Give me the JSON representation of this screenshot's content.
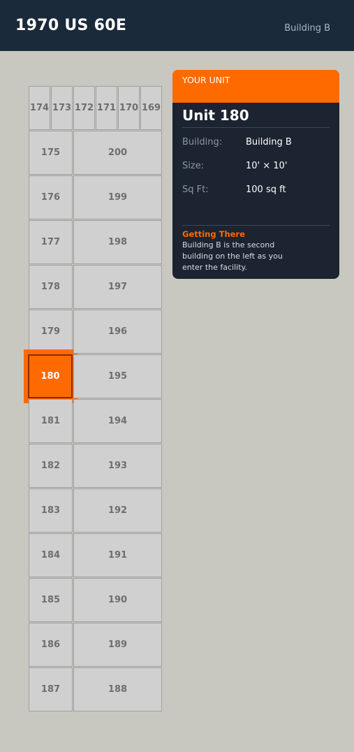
{
  "header": {
    "title": "1970 US 60E",
    "building": "Building B"
  },
  "map": {
    "top_row": [
      "174",
      "173",
      "172",
      "171",
      "170",
      "169"
    ],
    "left_column": [
      "175",
      "176",
      "177",
      "178",
      "179",
      "180",
      "181",
      "182",
      "183",
      "184",
      "185",
      "186",
      "187"
    ],
    "right_column": [
      "200",
      "199",
      "198",
      "197",
      "196",
      "195",
      "194",
      "193",
      "192",
      "191",
      "190",
      "189",
      "188"
    ],
    "highlighted_unit": "180"
  },
  "panel": {
    "band_label": "YOUR UNIT",
    "unit_title": "Unit 180",
    "building_label": "Building:",
    "building_value": "Building B",
    "size_label": "Size:",
    "size_value": "10' × 10'",
    "sqft_label": "Sq Ft:",
    "sqft_value": "100 sq ft",
    "getting_there_title": "Getting There",
    "getting_there_text": "Building B is the second building on the left as you enter the facility."
  },
  "colors": {
    "header_bg": "#1b2a3a",
    "accent": "#ff6a00",
    "panel_bg": "#1b2430",
    "unit_bg": "#d0d0d0",
    "page_bg": "#c8c8c0"
  }
}
